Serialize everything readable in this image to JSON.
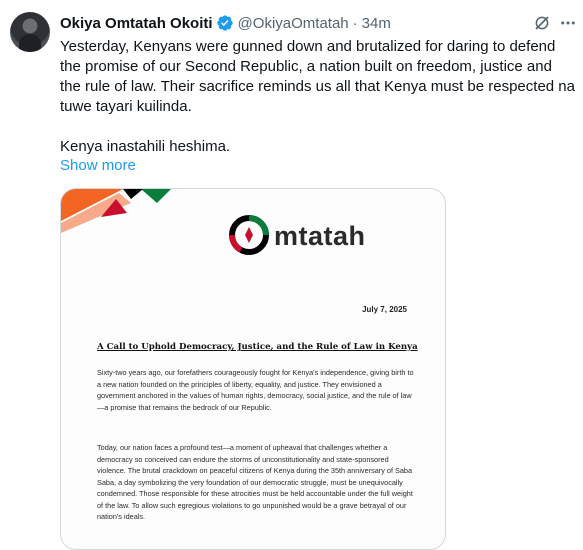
{
  "author": {
    "name": "Okiya Omtatah Okoiti",
    "handle": "@OkiyaOmtatah",
    "separator": "·",
    "time": "34m",
    "verified_color": "#1d9bf0"
  },
  "tweet": {
    "paragraphs": [
      "Yesterday, Kenyans were gunned down and brutalized for daring to defend the promise of our Second Republic, a nation built on freedom, justice and the rule of law. Their sacrifice reminds us all that Kenya must be respected na tuwe tayari kuilinda.",
      "Kenya inastahili heshima."
    ],
    "show_more_label": "Show more"
  },
  "media": {
    "logo_text": "mtatah",
    "date": "July 7, 2025",
    "title": "A Call to Uphold Democracy, Justice, and the Rule of Law in Kenya",
    "paragraphs": [
      "Sixty-two years ago, our forefathers courageously fought for Kenya's independence, giving birth to a new nation founded on the principles of liberty, equality, and justice. They envisioned a government anchored in the values of human rights, democracy, social justice, and the rule of law—a promise that remains the bedrock of our Republic.",
      "Today, our nation faces a profound test—a moment of upheaval that challenges whether a democracy so conceived can endure the storms of unconstitutionality and state-sponsored violence. The brutal crackdown on peaceful citizens of Kenya during the 35th anniversary of Saba Saba, a day symbolizing the very foundation of our democratic struggle, must be unequivocally condemned. Those responsible for these atrocities must be held accountable under the full weight of the law. To allow such egregious violations to go unpunished would be a grave betrayal of our nation's ideals."
    ]
  },
  "icons": {
    "verified": "verified-badge-icon",
    "grok": "grok-icon",
    "more": "more-options-icon"
  },
  "colors": {
    "text": "#0f1419",
    "secondary": "#536471",
    "link": "#1d9bf0",
    "flag_green": "#0a7d3b",
    "flag_red": "#c8102e",
    "flag_black": "#000000",
    "orange": "#f26522"
  }
}
